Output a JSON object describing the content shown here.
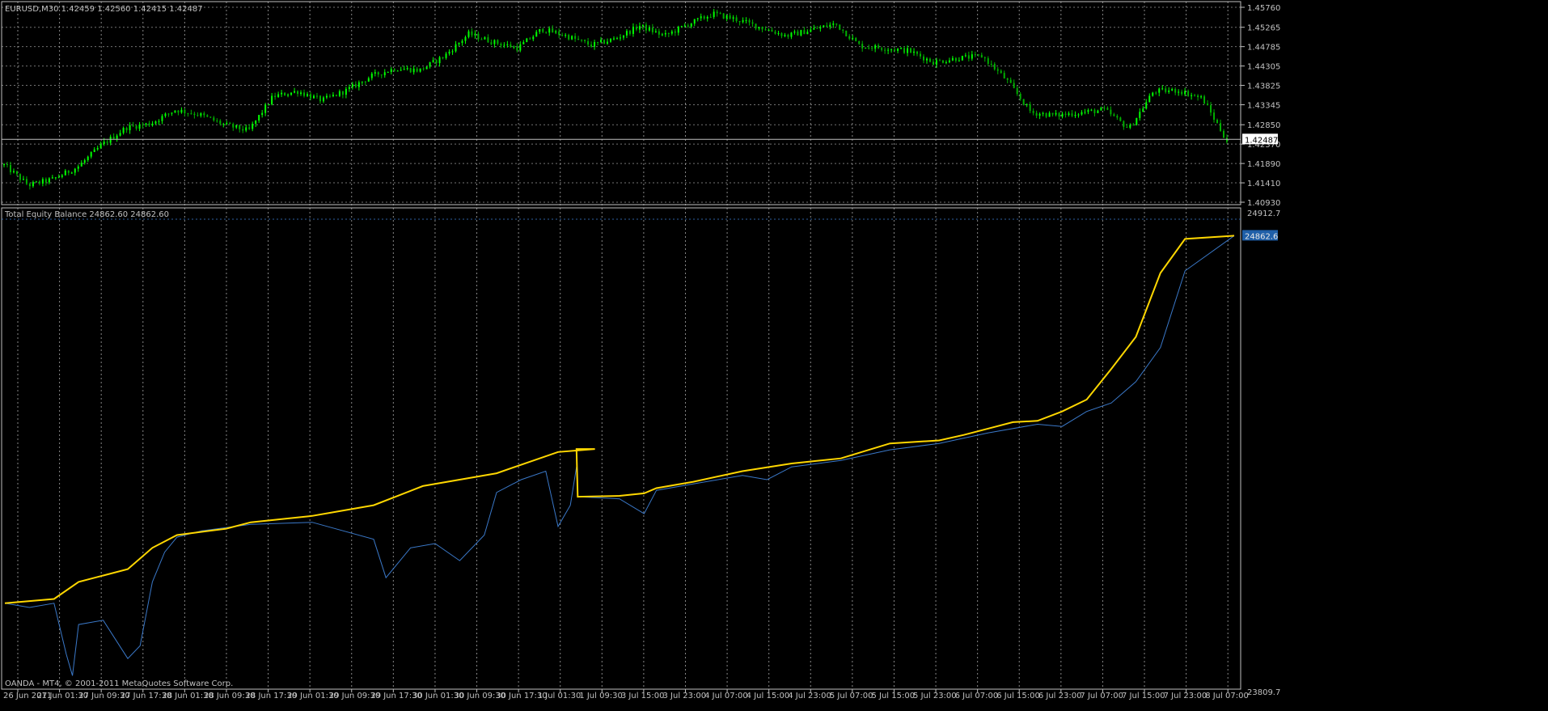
{
  "price_pane": {
    "title": "EURUSD,M30  1.42459 1.42560 1.42415 1.42487",
    "current_price_label": "1.42487"
  },
  "equity_pane": {
    "title": "Total Equity Balance 24862.60 24862.60",
    "current_value_label": "24862.6"
  },
  "footer": {
    "copyright": "OANDA - MT4, © 2001-2011 MetaQuotes Software Corp."
  },
  "colors": {
    "background": "#000000",
    "grid": "#c0c0c0",
    "axis": "#c0c0c0",
    "text": "#c0c0c0",
    "candle_up": "#00ff00",
    "candle_down": "#00b000",
    "balance_line": "#ffd700",
    "equity_line": "#3a78c8",
    "price_line": "#c0c0c0",
    "value_box": "#1f5fa8"
  },
  "chart_data": [
    {
      "type": "candlestick",
      "title": "EURUSD,M30",
      "ylim": [
        1.4093,
        1.4576
      ],
      "y_ticks": [
        "1.45760",
        "1.45265",
        "1.44785",
        "1.44305",
        "1.43825",
        "1.43345",
        "1.42850",
        "1.42370",
        "1.41890",
        "1.41410",
        "1.40930"
      ],
      "x_ticks": [
        "26 Jun 2011",
        "27 Jun 01:30",
        "27 Jun 09:30",
        "27 Jun 17:30",
        "28 Jun 01:30",
        "28 Jun 09:30",
        "28 Jun 17:30",
        "29 Jun 01:30",
        "29 Jun 09:30",
        "29 Jun 17:30",
        "30 Jun 01:30",
        "30 Jun 09:30",
        "30 Jun 17:30",
        "1 Jul 01:30",
        "1 Jul 09:30",
        "3 Jul 15:00",
        "3 Jul 23:00",
        "4 Jul 07:00",
        "4 Jul 15:00",
        "4 Jul 23:00",
        "5 Jul 07:00",
        "5 Jul 15:00",
        "5 Jul 23:00",
        "6 Jul 07:00",
        "6 Jul 15:00",
        "6 Jul 23:00",
        "7 Jul 07:00",
        "7 Jul 15:00",
        "7 Jul 23:00",
        "8 Jul 07:00"
      ],
      "close_path_x": [
        0,
        0.02,
        0.04,
        0.06,
        0.08,
        0.1,
        0.12,
        0.14,
        0.16,
        0.18,
        0.2,
        0.22,
        0.24,
        0.26,
        0.28,
        0.3,
        0.32,
        0.34,
        0.36,
        0.38,
        0.4,
        0.42,
        0.44,
        0.46,
        0.48,
        0.5,
        0.52,
        0.54,
        0.56,
        0.58,
        0.6,
        0.62,
        0.64,
        0.66,
        0.68,
        0.7,
        0.72,
        0.74,
        0.76,
        0.78,
        0.8,
        0.82,
        0.84,
        0.86,
        0.88,
        0.9,
        0.92,
        0.94,
        0.96,
        0.98,
        1.0
      ],
      "close": [
        1.4185,
        1.4135,
        1.415,
        1.418,
        1.4235,
        1.4278,
        1.4288,
        1.4322,
        1.431,
        1.4285,
        1.427,
        1.4355,
        1.4368,
        1.4345,
        1.437,
        1.4405,
        1.4425,
        1.442,
        1.4455,
        1.451,
        1.449,
        1.4475,
        1.4522,
        1.4505,
        1.4482,
        1.4498,
        1.453,
        1.4505,
        1.4535,
        1.456,
        1.4545,
        1.4525,
        1.4505,
        1.452,
        1.4535,
        1.448,
        1.4475,
        1.4468,
        1.444,
        1.445,
        1.4455,
        1.4395,
        1.4315,
        1.4308,
        1.4315,
        1.4322,
        1.4275,
        1.4368,
        1.437,
        1.435,
        1.4245
      ],
      "current_price": 1.42487
    },
    {
      "type": "line",
      "title": "Total Equity Balance",
      "ylim": [
        23809.7,
        24912.7
      ],
      "y_ticks": [
        "24912.7",
        "23809.7"
      ],
      "series": [
        {
          "name": "Balance",
          "x": [
            0,
            0.04,
            0.06,
            0.1,
            0.12,
            0.14,
            0.18,
            0.2,
            0.25,
            0.3,
            0.34,
            0.4,
            0.45,
            0.48,
            0.465,
            0.466,
            0.5,
            0.52,
            0.53,
            0.56,
            0.6,
            0.64,
            0.68,
            0.72,
            0.76,
            0.78,
            0.8,
            0.82,
            0.84,
            0.86,
            0.88,
            0.9,
            0.92,
            0.94,
            0.96,
            1.0
          ],
          "values": [
            24000,
            24010,
            24050,
            24080,
            24130,
            24160,
            24175,
            24190,
            24205,
            24230,
            24275,
            24305,
            24355,
            24362,
            24362,
            24250,
            24252,
            24258,
            24270,
            24285,
            24310,
            24328,
            24340,
            24375,
            24382,
            24395,
            24410,
            24425,
            24428,
            24450,
            24478,
            24550,
            24625,
            24775,
            24855,
            24862.6
          ]
        },
        {
          "name": "Equity",
          "x": [
            0,
            0.02,
            0.04,
            0.05,
            0.055,
            0.06,
            0.08,
            0.1,
            0.11,
            0.12,
            0.13,
            0.14,
            0.16,
            0.2,
            0.25,
            0.3,
            0.31,
            0.33,
            0.35,
            0.37,
            0.39,
            0.4,
            0.42,
            0.44,
            0.45,
            0.46,
            0.465,
            0.466,
            0.5,
            0.52,
            0.53,
            0.56,
            0.6,
            0.62,
            0.64,
            0.68,
            0.72,
            0.76,
            0.8,
            0.84,
            0.86,
            0.88,
            0.9,
            0.92,
            0.94,
            0.96,
            1.0
          ],
          "values": [
            24000,
            23990,
            24000,
            23880,
            23830,
            23950,
            23960,
            23870,
            23900,
            24050,
            24120,
            24155,
            24170,
            24185,
            24190,
            24150,
            24060,
            24130,
            24140,
            24100,
            24160,
            24260,
            24290,
            24310,
            24180,
            24230,
            24320,
            24250,
            24245,
            24210,
            24265,
            24280,
            24300,
            24290,
            24320,
            24335,
            24360,
            24375,
            24400,
            24420,
            24415,
            24450,
            24470,
            24520,
            24600,
            24780,
            24862.6
          ]
        }
      ],
      "current_value": 24862.6
    }
  ]
}
